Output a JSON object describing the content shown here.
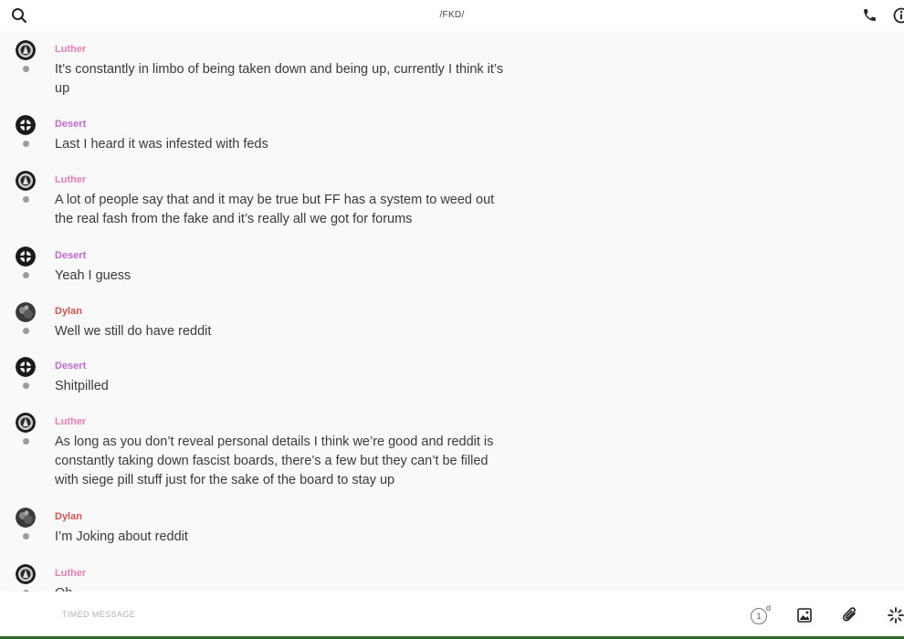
{
  "header": {
    "title": "/FKD/"
  },
  "messages": [
    {
      "author": "Luther",
      "text": "It’s constantly in limbo of being taken down and being up, currently I think it’s up"
    },
    {
      "author": "Desert",
      "text": "Last I heard it was infested with feds"
    },
    {
      "author": "Luther",
      "text": "A lot of people say that and it may be true but FF has a system to weed out the real fash from the fake and it’s really all we got for forums"
    },
    {
      "author": "Desert",
      "text": "Yeah I guess"
    },
    {
      "author": "Dylan",
      "text": "Well we still do have reddit"
    },
    {
      "author": "Desert",
      "text": "Shitpilled"
    },
    {
      "author": "Luther",
      "text": "As long as you don’t reveal personal details I think we’re good and reddit is constantly taking down fascist boards, there’s a few but they can’t be filled with siege pill stuff just for the sake of the board to stay up"
    },
    {
      "author": "Dylan",
      "text": "I’m Joking about reddit"
    },
    {
      "author": "Luther",
      "text": "Oh"
    }
  ],
  "composer": {
    "placeholder": "TIMED MESSAGE",
    "timer_value": "1",
    "timer_unit": "d"
  },
  "colors": {
    "luther": "#e97eb6",
    "desert": "#c468d4",
    "dylan": "#d9534f",
    "bottom_border": "#2d6b2d"
  },
  "icons": [
    "search-icon",
    "phone-icon",
    "info-icon",
    "hourglass-timer-icon",
    "image-icon",
    "paperclip-icon",
    "sparkle-icon"
  ]
}
